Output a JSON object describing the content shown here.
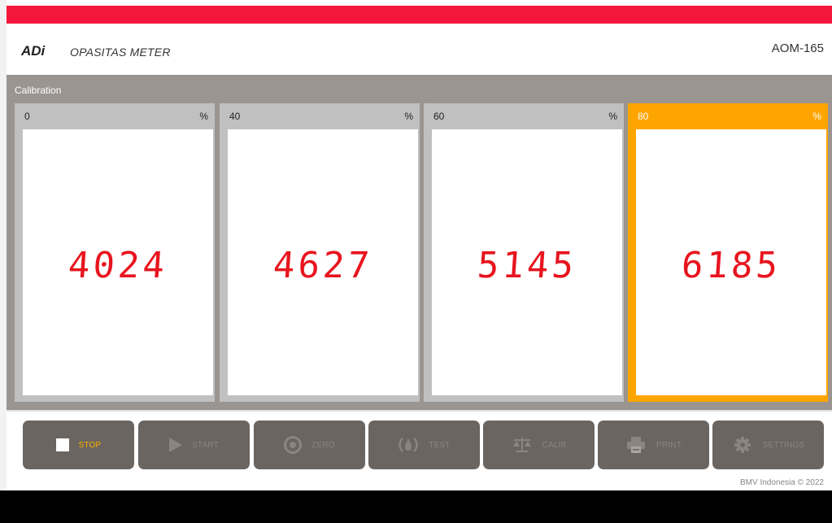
{
  "header": {
    "brand": "ADi",
    "subtitle": "OPASITAS METER",
    "model": "AOM-165"
  },
  "panel": {
    "title": "Calibration",
    "cards": [
      {
        "percent": "0",
        "unit": "%",
        "reading": "4024",
        "active": false
      },
      {
        "percent": "40",
        "unit": "%",
        "reading": "4627",
        "active": false
      },
      {
        "percent": "60",
        "unit": "%",
        "reading": "5145",
        "active": false
      },
      {
        "percent": "80",
        "unit": "%",
        "reading": "6185",
        "active": true
      }
    ]
  },
  "toolbar": {
    "buttons": [
      {
        "label": "STOP",
        "icon": "stop-square-icon",
        "active": true
      },
      {
        "label": "START",
        "icon": "play-icon",
        "active": false
      },
      {
        "label": "ZERO",
        "icon": "target-icon",
        "active": false
      },
      {
        "label": "TEST",
        "icon": "smoke-gauge-icon",
        "active": false
      },
      {
        "label": "CALIB",
        "icon": "balance-scale-icon",
        "active": false
      },
      {
        "label": "PRINT",
        "icon": "printer-icon",
        "active": false
      },
      {
        "label": "SETTINGS",
        "icon": "gear-icon",
        "active": false
      }
    ]
  },
  "footer": {
    "copyright": "BMV Indonesia © 2022"
  },
  "colors": {
    "brand_red": "#f5173b",
    "active_orange": "#ffa500",
    "segment_red": "#e8141e",
    "panel_gray": "#9a9591",
    "button_gray": "#6a6560"
  }
}
